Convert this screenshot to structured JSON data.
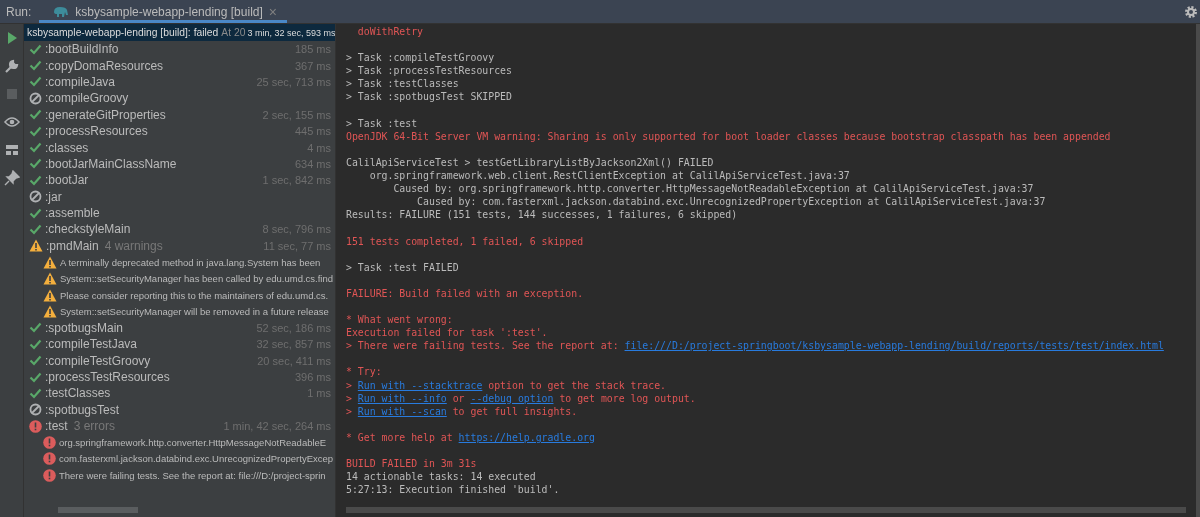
{
  "run_bar": {
    "label": "Run:",
    "tab": {
      "title": "ksbysample-webapp-lending [build]",
      "close": "×",
      "selected": true
    }
  },
  "toolbar": [
    {
      "kind": "rerun"
    },
    {
      "kind": "settings"
    },
    {
      "kind": "stop"
    },
    {
      "kind": "view"
    },
    {
      "kind": "layout"
    },
    {
      "kind": "pin"
    }
  ],
  "tree": {
    "header": {
      "title": "ksbysample-webapp-lending [build]:",
      "result": "failed",
      "started": "At 20",
      "time": "3 min, 32 sec, 593 ms",
      "selected": true
    },
    "items": [
      {
        "kind": "success",
        "label": ":bootBuildInfo",
        "time": "185 ms"
      },
      {
        "kind": "success",
        "label": ":copyDomaResources",
        "time": "367 ms"
      },
      {
        "kind": "success",
        "label": ":compileJava",
        "time": "25 sec, 713 ms"
      },
      {
        "kind": "skipped",
        "label": ":compileGroovy"
      },
      {
        "kind": "success",
        "label": ":generateGitProperties",
        "time": "2 sec, 155 ms"
      },
      {
        "kind": "success",
        "label": ":processResources",
        "time": "445 ms"
      },
      {
        "kind": "success",
        "label": ":classes",
        "time": "4 ms"
      },
      {
        "kind": "success",
        "label": ":bootJarMainClassName",
        "time": "634 ms"
      },
      {
        "kind": "success",
        "label": ":bootJar",
        "time": "1 sec, 842 ms"
      },
      {
        "kind": "skipped",
        "label": ":jar"
      },
      {
        "kind": "success",
        "label": ":assemble"
      },
      {
        "kind": "success",
        "label": ":checkstyleMain",
        "time": "8 sec, 796 ms"
      },
      {
        "kind": "warning",
        "label": ":pmdMain",
        "note": "4 warnings",
        "time": "11 sec, 77 ms",
        "children": [
          {
            "kind": "warning",
            "label": "A terminally deprecated method in java.lang.System has been"
          },
          {
            "kind": "warning",
            "label": "System::setSecurityManager has been called by edu.umd.cs.find"
          },
          {
            "kind": "warning",
            "label": "Please consider reporting this to the maintainers of edu.umd.cs."
          },
          {
            "kind": "warning",
            "label": "System::setSecurityManager will be removed in a future release"
          }
        ]
      },
      {
        "kind": "success",
        "label": ":spotbugsMain",
        "time": "52 sec, 186 ms"
      },
      {
        "kind": "success",
        "label": ":compileTestJava",
        "time": "32 sec, 857 ms"
      },
      {
        "kind": "success",
        "label": ":compileTestGroovy",
        "time": "20 sec, 411 ms"
      },
      {
        "kind": "success",
        "label": ":processTestResources",
        "time": "396 ms"
      },
      {
        "kind": "success",
        "label": ":testClasses",
        "time": "1 ms"
      },
      {
        "kind": "skipped",
        "label": ":spotbugsTest"
      },
      {
        "kind": "error",
        "label": ":test",
        "note": "3 errors",
        "time": "1 min, 42 sec, 264 ms",
        "children": [
          {
            "kind": "error",
            "label": "org.springframework.http.converter.HttpMessageNotReadableE"
          },
          {
            "kind": "error",
            "label": "com.fasterxml.jackson.databind.exc.UnrecognizedPropertyExcep"
          },
          {
            "kind": "error",
            "label": "There were failing tests. See the report at: file:///D:/project-sprin"
          }
        ]
      }
    ]
  },
  "console": [
    {
      "kind": "error",
      "parts": [
        {
          "text": "  doWithRetry"
        }
      ]
    },
    {
      "kind": "blank"
    },
    {
      "kind": "normal",
      "parts": [
        {
          "text": "> Task :compileTestGroovy"
        }
      ]
    },
    {
      "kind": "normal",
      "parts": [
        {
          "text": "> Task :processTestResources"
        }
      ]
    },
    {
      "kind": "normal",
      "parts": [
        {
          "text": "> Task :testClasses"
        }
      ]
    },
    {
      "kind": "normal",
      "parts": [
        {
          "text": "> Task :spotbugsTest SKIPPED"
        }
      ]
    },
    {
      "kind": "blank"
    },
    {
      "kind": "normal",
      "parts": [
        {
          "text": "> Task :test"
        }
      ]
    },
    {
      "kind": "error",
      "parts": [
        {
          "text": "OpenJDK 64-Bit Server VM warning: Sharing is only supported for boot loader classes because bootstrap classpath has been appended"
        }
      ]
    },
    {
      "kind": "blank"
    },
    {
      "kind": "normal",
      "parts": [
        {
          "text": "CalilApiServiceTest > testGetLibraryListByJackson2Xml() FAILED"
        }
      ]
    },
    {
      "kind": "normal",
      "parts": [
        {
          "text": "    org.springframework.web.client.RestClientException at CalilApiServiceTest.java:37"
        }
      ]
    },
    {
      "kind": "normal",
      "parts": [
        {
          "text": "        Caused by: org.springframework.http.converter.HttpMessageNotReadableException at CalilApiServiceTest.java:37"
        }
      ]
    },
    {
      "kind": "normal",
      "parts": [
        {
          "text": "            Caused by: com.fasterxml.jackson.databind.exc.UnrecognizedPropertyException at CalilApiServiceTest.java:37"
        }
      ]
    },
    {
      "kind": "normal",
      "parts": [
        {
          "text": "Results: FAILURE (151 tests, 144 successes, 1 failures, 6 skipped)"
        }
      ]
    },
    {
      "kind": "blank"
    },
    {
      "kind": "error",
      "parts": [
        {
          "text": "151 tests completed, 1 failed, 6 skipped"
        }
      ]
    },
    {
      "kind": "blank"
    },
    {
      "kind": "normal",
      "parts": [
        {
          "text": "> Task :test FAILED"
        }
      ]
    },
    {
      "kind": "blank"
    },
    {
      "kind": "error",
      "parts": [
        {
          "text": "FAILURE: Build failed with an exception."
        }
      ]
    },
    {
      "kind": "blank"
    },
    {
      "kind": "error",
      "parts": [
        {
          "text": "* What went wrong:"
        }
      ]
    },
    {
      "kind": "error",
      "parts": [
        {
          "text": "Execution failed for task ':test'."
        }
      ]
    },
    {
      "kind": "error",
      "parts": [
        {
          "text": "> There were failing tests. See the report at: "
        },
        {
          "text": "file:///D:/project-springboot/ksbysample-webapp-lending/build/reports/tests/test/index.html",
          "link": true
        }
      ]
    },
    {
      "kind": "blank"
    },
    {
      "kind": "error",
      "parts": [
        {
          "text": "* Try:"
        }
      ]
    },
    {
      "kind": "error",
      "parts": [
        {
          "text": "> "
        },
        {
          "text": "Run with --stacktrace",
          "link": true
        },
        {
          "text": " option to get the stack trace."
        }
      ]
    },
    {
      "kind": "error",
      "parts": [
        {
          "text": "> "
        },
        {
          "text": "Run with --info",
          "link": true
        },
        {
          "text": " or "
        },
        {
          "text": "--debug option",
          "link": true
        },
        {
          "text": " to get more log output."
        }
      ]
    },
    {
      "kind": "error",
      "parts": [
        {
          "text": "> "
        },
        {
          "text": "Run with --scan",
          "link": true
        },
        {
          "text": " to get full insights."
        }
      ]
    },
    {
      "kind": "blank"
    },
    {
      "kind": "error",
      "parts": [
        {
          "text": "* Get more help at "
        },
        {
          "text": "https://help.gradle.org",
          "link": true
        }
      ]
    },
    {
      "kind": "blank"
    },
    {
      "kind": "error",
      "parts": [
        {
          "text": "BUILD FAILED in 3m 31s"
        }
      ]
    },
    {
      "kind": "normal",
      "parts": [
        {
          "text": "14 actionable tasks: 14 executed"
        }
      ]
    },
    {
      "kind": "normal",
      "parts": [
        {
          "text": "5:27:13: Execution finished 'build'."
        }
      ]
    }
  ]
}
